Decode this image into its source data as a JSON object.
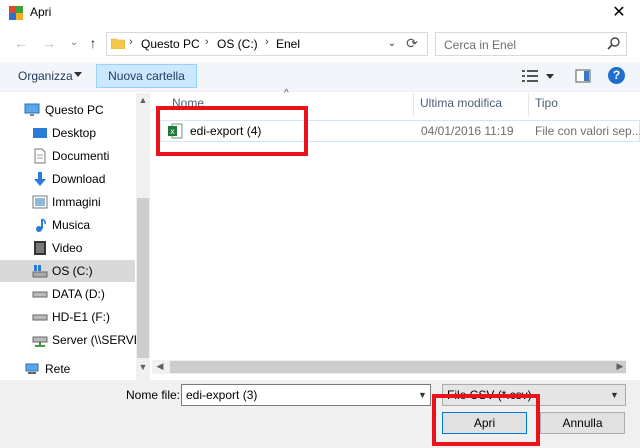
{
  "window": {
    "title": "Apri",
    "close_label": "✕"
  },
  "nav": {
    "back": "←",
    "forward": "→",
    "up": "↑",
    "breadcrumb": [
      "Questo PC",
      "OS (C:)",
      "Enel"
    ],
    "separator": "›",
    "search_placeholder": "Cerca in Enel"
  },
  "toolbar": {
    "organize_label": "Organizza",
    "new_folder_label": "Nuova cartella",
    "help_label": "?"
  },
  "sidebar": {
    "items": [
      {
        "label": "Questo PC",
        "icon": "computer-icon"
      },
      {
        "label": "Desktop",
        "icon": "desktop-icon"
      },
      {
        "label": "Documenti",
        "icon": "documents-icon"
      },
      {
        "label": "Download",
        "icon": "download-icon"
      },
      {
        "label": "Immagini",
        "icon": "pictures-icon"
      },
      {
        "label": "Musica",
        "icon": "music-icon"
      },
      {
        "label": "Video",
        "icon": "video-icon"
      },
      {
        "label": "OS (C:)",
        "icon": "os-drive-icon",
        "selected": true
      },
      {
        "label": "DATA (D:)",
        "icon": "drive-icon"
      },
      {
        "label": "HD-E1 (F:)",
        "icon": "drive-icon"
      },
      {
        "label": "Server (\\\\SERVER",
        "icon": "network-drive-icon"
      },
      {
        "label": "Rete",
        "icon": "network-icon"
      }
    ]
  },
  "filelist": {
    "columns": [
      "Nome",
      "Ultima modifica",
      "Tipo"
    ],
    "rows": [
      {
        "name": "edi-export (4)",
        "modified": "04/01/2016 11:19",
        "type": "File con valori sep..."
      }
    ]
  },
  "footer": {
    "filename_label": "Nome file:",
    "filename_value": "edi-export (3)",
    "filetype_value": "File CSV (*.csv)",
    "open_label": "Apri",
    "cancel_label": "Annulla"
  },
  "colors": {
    "accent": "#0078d7",
    "selection": "#cce8ff",
    "annotation": "#e8141a"
  }
}
